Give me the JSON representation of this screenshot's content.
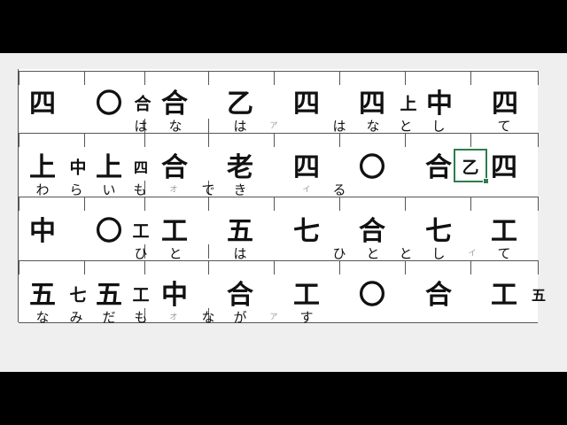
{
  "rows": [
    {
      "chars": [
        {
          "t": "四",
          "s": "big"
        },
        {
          "t": "〇",
          "s": "big"
        },
        {
          "t": "合",
          "s": "small"
        },
        {
          "t": "合",
          "s": "big"
        },
        {
          "t": "乙",
          "s": "big"
        },
        {
          "t": "四",
          "s": "big"
        },
        {
          "t": "四",
          "s": "big"
        },
        {
          "t": "上",
          "s": "small"
        },
        {
          "t": "中",
          "s": "big"
        },
        {
          "t": "四",
          "s": "big"
        }
      ],
      "kana": [
        {
          "t": "は",
          "f": false
        },
        {
          "t": "な",
          "f": false
        },
        {
          "t": "は",
          "f": false
        },
        {
          "t": "ア",
          "f": true
        },
        {
          "t": "は",
          "f": false
        },
        {
          "t": "な",
          "f": false
        },
        {
          "t": "と",
          "f": false
        },
        {
          "t": "し",
          "f": false
        },
        {
          "t": "て",
          "f": false
        }
      ]
    },
    {
      "chars": [
        {
          "t": "上",
          "s": "big"
        },
        {
          "t": "中",
          "s": "small"
        },
        {
          "t": "上",
          "s": "big"
        },
        {
          "t": "四",
          "s": "tiny"
        },
        {
          "t": "合",
          "s": "big"
        },
        {
          "t": "老",
          "s": "big"
        },
        {
          "t": "四",
          "s": "big"
        },
        {
          "t": "〇",
          "s": "big"
        },
        {
          "t": "合",
          "s": "big"
        },
        {
          "t": "乙",
          "s": "small"
        },
        {
          "t": "四",
          "s": "big"
        }
      ],
      "kana": [
        {
          "t": "わ",
          "f": false
        },
        {
          "t": "ら",
          "f": false
        },
        {
          "t": "い",
          "f": false
        },
        {
          "t": "も",
          "f": false
        },
        {
          "t": "オ",
          "f": true
        },
        {
          "t": "で",
          "f": false
        },
        {
          "t": "き",
          "f": false
        },
        {
          "t": "イ",
          "f": true
        },
        {
          "t": "る",
          "f": false
        }
      ]
    },
    {
      "chars": [
        {
          "t": "中",
          "s": "big"
        },
        {
          "t": "〇",
          "s": "big"
        },
        {
          "t": "工",
          "s": "small"
        },
        {
          "t": "工",
          "s": "big"
        },
        {
          "t": "五",
          "s": "big"
        },
        {
          "t": "七",
          "s": "big"
        },
        {
          "t": "合",
          "s": "big"
        },
        {
          "t": "七",
          "s": "big"
        },
        {
          "t": "工",
          "s": "big"
        }
      ],
      "kana": [
        {
          "t": "ひ",
          "f": false
        },
        {
          "t": "と",
          "f": false
        },
        {
          "t": "は",
          "f": false
        },
        {
          "t": "ひ",
          "f": false
        },
        {
          "t": "と",
          "f": false
        },
        {
          "t": "と",
          "f": false
        },
        {
          "t": "し",
          "f": false
        },
        {
          "t": "イ",
          "f": true
        },
        {
          "t": "て",
          "f": false
        }
      ]
    },
    {
      "chars": [
        {
          "t": "五",
          "s": "big"
        },
        {
          "t": "七",
          "s": "small"
        },
        {
          "t": "五",
          "s": "big"
        },
        {
          "t": "工",
          "s": "small"
        },
        {
          "t": "中",
          "s": "big"
        },
        {
          "t": "合",
          "s": "big"
        },
        {
          "t": "工",
          "s": "big"
        },
        {
          "t": "〇",
          "s": "big"
        },
        {
          "t": "合",
          "s": "big"
        },
        {
          "t": "工",
          "s": "big"
        },
        {
          "t": "五",
          "s": "tiny"
        }
      ],
      "kana": [
        {
          "t": "な",
          "f": false
        },
        {
          "t": "み",
          "f": false
        },
        {
          "t": "だ",
          "f": false
        },
        {
          "t": "も",
          "f": false
        },
        {
          "t": "オ",
          "f": true
        },
        {
          "t": "な",
          "f": false
        },
        {
          "t": "が",
          "f": false
        },
        {
          "t": "ア",
          "f": true
        },
        {
          "t": "す",
          "f": false
        }
      ]
    }
  ]
}
